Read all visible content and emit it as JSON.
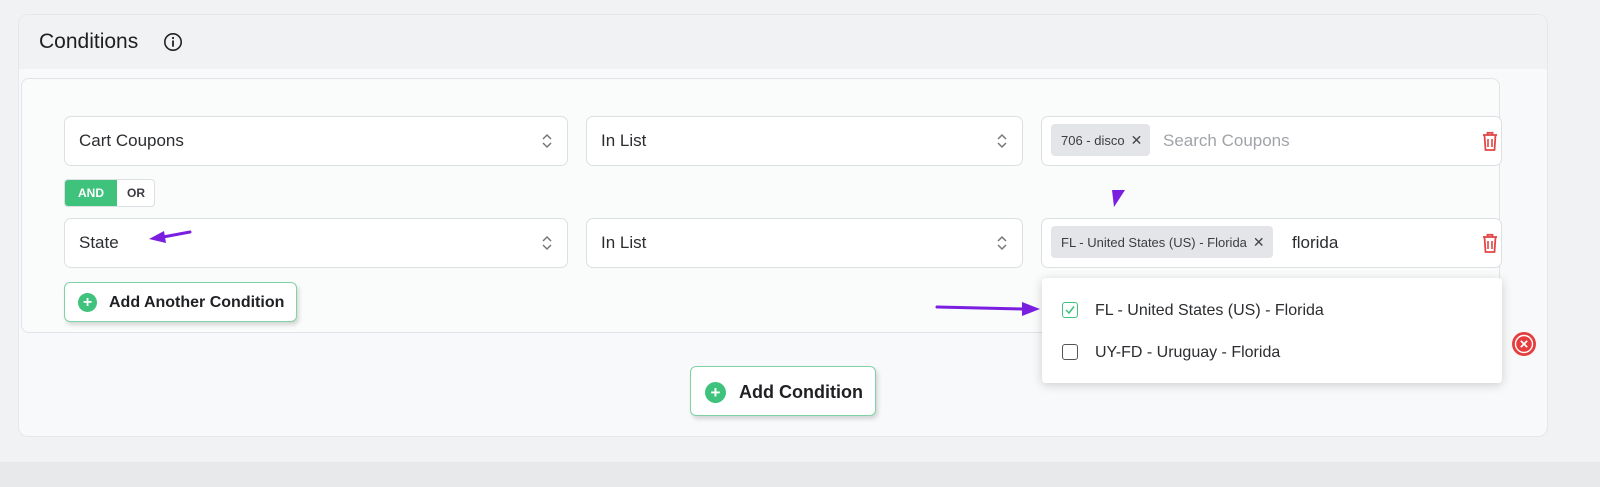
{
  "panel": {
    "title": "Conditions",
    "info_icon": "info-icon"
  },
  "conditions": [
    {
      "type": "Cart Coupons",
      "operator": "In List",
      "tags": [
        {
          "label": "706 - disco"
        }
      ],
      "search_placeholder": "Search Coupons",
      "search_value": ""
    },
    {
      "type": "State",
      "operator": "In List",
      "tags": [
        {
          "label": "FL - United States (US) - Florida"
        }
      ],
      "search_placeholder": "",
      "search_value": "florida"
    }
  ],
  "logic": {
    "and_label": "AND",
    "or_label": "OR",
    "active": "AND"
  },
  "add_another_label": "Add Another Condition",
  "add_condition_label": "Add Condition",
  "dropdown": {
    "options": [
      {
        "label": "FL - United States (US) - Florida",
        "checked": true
      },
      {
        "label": "UY-FD - Uruguay - Florida",
        "checked": false
      }
    ]
  },
  "colors": {
    "accent_green": "#3ec27c",
    "delete_red": "#e04848",
    "annotation_purple": "#7a1fe0"
  }
}
